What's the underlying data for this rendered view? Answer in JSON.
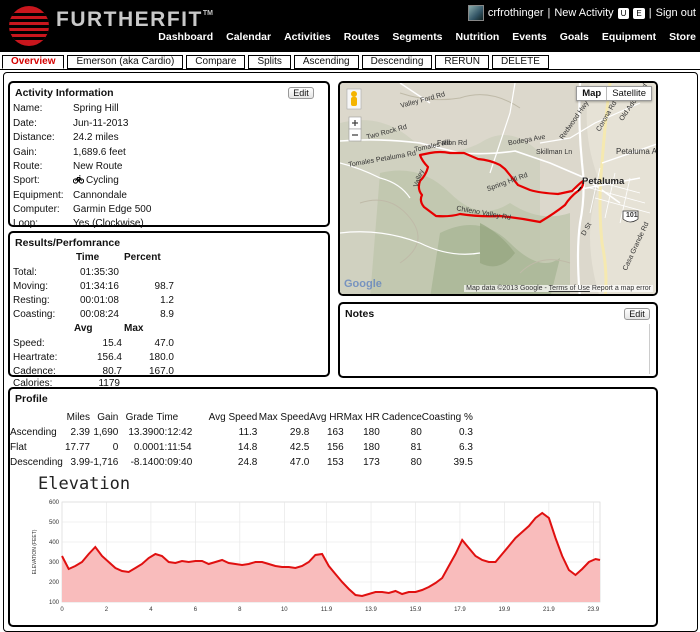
{
  "header": {
    "brand": "FURTHERFIT",
    "brand_tm": "TM",
    "user": {
      "name": "crfrothinger",
      "sep1": "|",
      "new_activity": "New Activity",
      "btn_u": "U",
      "btn_e": "E",
      "sep2": "|",
      "sign_out": "Sign out"
    },
    "nav": [
      "Dashboard",
      "Calendar",
      "Activities",
      "Routes",
      "Segments",
      "Nutrition",
      "Events",
      "Goals",
      "Equipment",
      "Store"
    ]
  },
  "tabs": [
    "Overview",
    "Emerson (aka Cardio)",
    "Compare",
    "Splits",
    "Ascending",
    "Descending",
    "RERUN",
    "DELETE"
  ],
  "activity": {
    "title": "Activity Information",
    "edit_label": "Edit",
    "rows": [
      {
        "k": "Name:",
        "v": "Spring Hill"
      },
      {
        "k": "Date:",
        "v": "Jun-11-2013"
      },
      {
        "k": "Distance:",
        "v": "24.2 miles"
      },
      {
        "k": "Gain:",
        "v": "1,689.6 feet"
      },
      {
        "k": "Route:",
        "v": "New Route"
      },
      {
        "k": "Sport:",
        "v": "Cycling"
      },
      {
        "k": "Equipment:",
        "v": "Cannondale"
      },
      {
        "k": "Computer:",
        "v": "Garmin Edge 500"
      },
      {
        "k": "Loop:",
        "v": "Yes (Clockwise)"
      }
    ]
  },
  "results": {
    "title": "Results/Perfomrance",
    "h1": [
      "Time",
      "Percent"
    ],
    "rows1": [
      {
        "k": "Total:",
        "t": "01:35:30",
        "p": ""
      },
      {
        "k": "Moving:",
        "t": "01:34:16",
        "p": "98.7"
      },
      {
        "k": "Resting:",
        "t": "00:01:08",
        "p": "1.2"
      },
      {
        "k": "Coasting:",
        "t": "00:08:24",
        "p": "8.9"
      }
    ],
    "h2": [
      "Avg",
      "Max"
    ],
    "rows2": [
      {
        "k": "Speed:",
        "a": "15.4",
        "m": "47.0"
      },
      {
        "k": "Heartrate:",
        "a": "156.4",
        "m": "180.0"
      },
      {
        "k": "Cadence:",
        "a": "80.7",
        "m": "167.0"
      },
      {
        "k": "Calories:",
        "a": "1179",
        "m": ""
      }
    ]
  },
  "map": {
    "btn_map": "Map",
    "btn_sat": "Satellite",
    "attrib_data": "Map data ©2013 Google",
    "attrib_sep": "-",
    "attrib_terms": "Terms of Use",
    "attrib_report": "Report a map error",
    "google": "Google",
    "labels": [
      {
        "t": "Valley Ford Rd"
      },
      {
        "t": "Two Rock Rd"
      },
      {
        "t": "Fallon Rd"
      },
      {
        "t": "Tomales Rd"
      },
      {
        "t": "Tomales Petaluma Rd"
      },
      {
        "t": "Bodega Ave"
      },
      {
        "t": "Skillman Ln"
      },
      {
        "t": "Redwood Hwy"
      },
      {
        "t": "Petaluma Adobe"
      },
      {
        "t": "Spring Hill Rd"
      },
      {
        "t": "Chileno Valley Rd"
      },
      {
        "t": "Petaluma"
      },
      {
        "t": "Valley"
      },
      {
        "t": "D St"
      },
      {
        "t": "101"
      },
      {
        "t": "Corona Rd"
      },
      {
        "t": "Old Adobe Rd"
      },
      {
        "t": "Casa Grande Rd"
      }
    ]
  },
  "notes": {
    "title": "Notes",
    "edit_label": "Edit"
  },
  "profile": {
    "title": "Profile",
    "columns": [
      "",
      "Miles",
      "Gain",
      "Grade",
      "Time",
      "Avg Speed",
      "Max Speed",
      "Avg HR",
      "Max HR",
      "Cadence",
      "Coasting %"
    ],
    "rows": [
      [
        "Ascending",
        "2.39",
        "1,690",
        "13.39",
        "00:12:42",
        "11.3",
        "29.8",
        "163",
        "180",
        "80",
        "0.3"
      ],
      [
        "Flat",
        "17.77",
        "0",
        "0.00",
        "01:11:54",
        "14.8",
        "42.5",
        "156",
        "180",
        "81",
        "6.3"
      ],
      [
        "Descending",
        "3.99",
        "-1,716",
        "-8.14",
        "00:09:40",
        "24.8",
        "47.0",
        "153",
        "173",
        "80",
        "39.5"
      ]
    ]
  },
  "colors": {
    "accent": "#d40000",
    "fill": "#f9bcbc",
    "line": "#e01010"
  },
  "chart_data": {
    "type": "area",
    "title": "Elevation",
    "xlabel": "",
    "ylabel": "ELEVATION (FEET)",
    "xlim": [
      0,
      24.2
    ],
    "ylim": [
      100,
      600
    ],
    "xticks": [
      0,
      2,
      4,
      6,
      8,
      10,
      11.9,
      13.9,
      15.9,
      17.9,
      19.9,
      21.9,
      23.9
    ],
    "xtick_labels": [
      "0",
      "2",
      "4",
      "6",
      "8",
      "10",
      "11.9",
      "13.9",
      "15.9",
      "17.9",
      "19.9",
      "21.9",
      "23.9"
    ],
    "yticks": [
      100,
      200,
      300,
      400,
      500,
      600
    ],
    "grid": true,
    "series": [
      {
        "x": [
          0,
          0.3,
          0.6,
          0.9,
          1.2,
          1.5,
          1.8,
          2.1,
          2.4,
          2.7,
          3.0,
          3.3,
          3.6,
          3.9,
          4.2,
          4.5,
          4.8,
          5.1,
          5.4,
          5.7,
          6.0,
          6.3,
          6.6,
          6.9,
          7.2,
          7.5,
          7.8,
          8.1,
          8.4,
          8.7,
          9.0,
          9.3,
          9.6,
          9.9,
          10.2,
          10.5,
          10.8,
          11.1,
          11.4,
          11.7,
          12.0,
          12.3,
          12.6,
          12.9,
          13.2,
          13.5,
          13.8,
          14.1,
          14.4,
          14.7,
          15.0,
          15.3,
          15.6,
          15.9,
          16.2,
          16.5,
          16.8,
          17.1,
          17.4,
          17.7,
          18.0,
          18.3,
          18.6,
          18.9,
          19.2,
          19.5,
          19.8,
          20.1,
          20.4,
          20.7,
          21.0,
          21.3,
          21.6,
          21.9,
          22.2,
          22.5,
          22.8,
          23.1,
          23.4,
          23.7,
          24.0,
          24.2
        ],
        "y": [
          330,
          265,
          280,
          300,
          340,
          375,
          330,
          300,
          270,
          255,
          250,
          270,
          290,
          320,
          340,
          330,
          300,
          295,
          305,
          300,
          305,
          305,
          290,
          300,
          310,
          295,
          290,
          285,
          290,
          300,
          300,
          290,
          280,
          275,
          275,
          270,
          280,
          300,
          335,
          340,
          280,
          240,
          200,
          165,
          135,
          130,
          140,
          150,
          150,
          145,
          155,
          140,
          150,
          150,
          160,
          175,
          195,
          220,
          280,
          340,
          410,
          370,
          330,
          310,
          300,
          300,
          340,
          380,
          420,
          450,
          480,
          520,
          545,
          520,
          420,
          330,
          260,
          235,
          265,
          300,
          315,
          310
        ]
      }
    ]
  }
}
